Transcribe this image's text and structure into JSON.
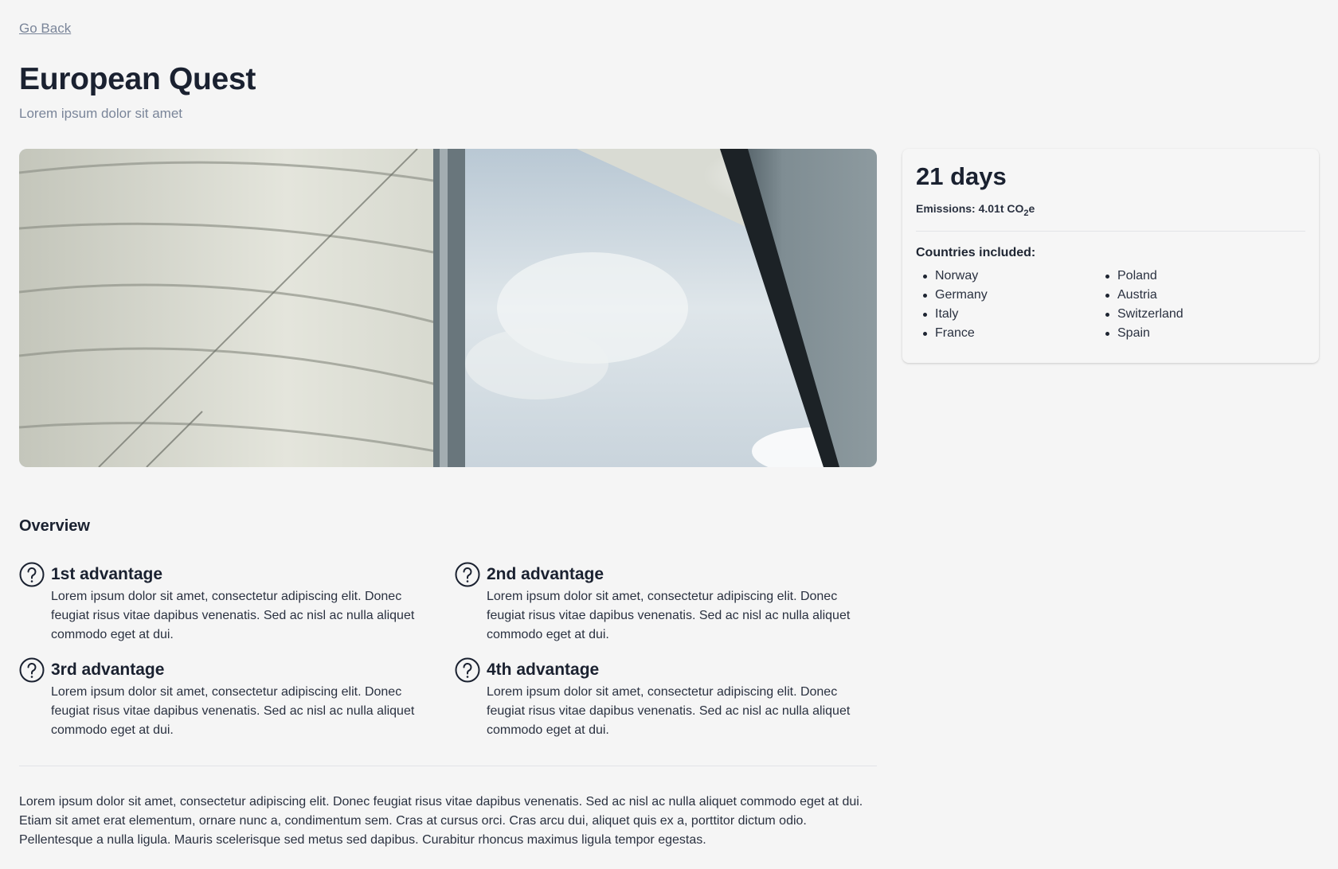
{
  "nav": {
    "back_label": "Go Back"
  },
  "header": {
    "title": "European Quest",
    "subtitle": "Lorem ipsum dolor sit amet"
  },
  "trip_card": {
    "duration": "21 days",
    "emissions_prefix": "Emissions: 4.01t CO",
    "emissions_sub": "2",
    "emissions_suffix": "e",
    "countries_heading": "Countries included:",
    "countries": [
      "Norway",
      "Germany",
      "Italy",
      "France",
      "Poland",
      "Austria",
      "Switzerland",
      "Spain"
    ]
  },
  "overview": {
    "heading": "Overview",
    "advantages": [
      {
        "icon": "question-circle-icon",
        "title": "1st advantage",
        "text": "Lorem ipsum dolor sit amet, consectetur adipiscing elit. Donec feugiat risus vitae dapibus venenatis. Sed ac nisl ac nulla aliquet commodo eget at dui."
      },
      {
        "icon": "question-circle-icon",
        "title": "2nd advantage",
        "text": "Lorem ipsum dolor sit amet, consectetur adipiscing elit. Donec feugiat risus vitae dapibus venenatis. Sed ac nisl ac nulla aliquet commodo eget at dui."
      },
      {
        "icon": "question-circle-icon",
        "title": "3rd advantage",
        "text": "Lorem ipsum dolor sit amet, consectetur adipiscing elit. Donec feugiat risus vitae dapibus venenatis. Sed ac nisl ac nulla aliquet commodo eget at dui."
      },
      {
        "icon": "question-circle-icon",
        "title": "4th advantage",
        "text": "Lorem ipsum dolor sit amet, consectetur adipiscing elit. Donec feugiat risus vitae dapibus venenatis. Sed ac nisl ac nulla aliquet commodo eget at dui."
      }
    ]
  },
  "description": "Lorem ipsum dolor sit amet, consectetur adipiscing elit. Donec feugiat risus vitae dapibus venenatis. Sed ac nisl ac nulla aliquet commodo eget at dui. Etiam sit amet erat elementum, ornare nunc a, condimentum sem. Cras at cursus orci. Cras arcu dui, aliquet quis ex a, porttitor dictum odio. Pellentesque a nulla ligula. Mauris scelerisque sed metus sed dapibus. Curabitur rhoncus maximus ligula tempor egestas.",
  "colors": {
    "background": "#f5f5f5",
    "text": "#1e2532",
    "muted": "#7a8599"
  }
}
